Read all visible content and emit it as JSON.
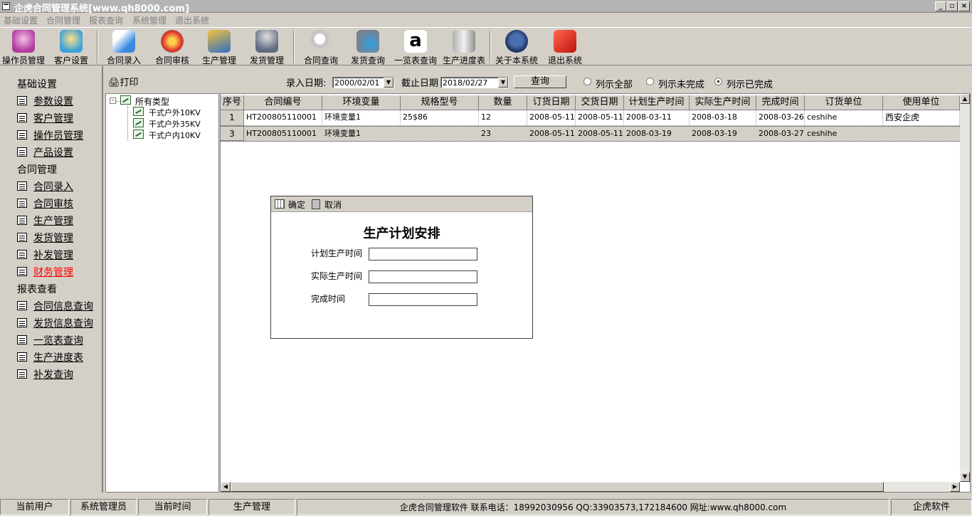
{
  "window": {
    "title": "企虎合同管理系统[www.qh8000.com]"
  },
  "menu": [
    "基础设置",
    "合同管理",
    "报表查询",
    "系统管理",
    "退出系统"
  ],
  "toolbar": [
    {
      "label": "操作员管理",
      "icon": "user-admin-icon"
    },
    {
      "label": "客户设置",
      "icon": "customer-icon"
    },
    {
      "label": "合同录入",
      "icon": "contract-entry-icon"
    },
    {
      "label": "合同审核",
      "icon": "audit-icon"
    },
    {
      "label": "生产管理",
      "icon": "production-icon"
    },
    {
      "label": "发货管理",
      "icon": "shipping-icon"
    },
    {
      "label": "合同查询",
      "icon": "search-icon"
    },
    {
      "label": "发货查询",
      "icon": "shipping-query-icon"
    },
    {
      "label": "一览表查询",
      "icon": "overview-icon"
    },
    {
      "label": "生产进度表",
      "icon": "progress-icon"
    },
    {
      "label": "关于本系统",
      "icon": "about-icon"
    },
    {
      "label": "退出系统",
      "icon": "exit-icon"
    }
  ],
  "nav": {
    "sections": [
      {
        "title": "基础设置",
        "items": [
          "参数设置",
          "客户管理",
          "操作员管理",
          "产品设置"
        ]
      },
      {
        "title": "合同管理",
        "items": [
          "合同录入",
          "合同审核",
          "生产管理",
          "发货管理",
          "补发管理",
          "财务管理"
        ]
      },
      {
        "title": "报表查看",
        "items": [
          "合同信息查询",
          "发货信息查询",
          "一览表查询",
          "生产进度表",
          "补发查询"
        ]
      }
    ],
    "highlight": "财务管理",
    "highlight_color": "#ff0000"
  },
  "filter": {
    "print": "打印",
    "entry_date_label": "录入日期:",
    "entry_date": "2000/02/01",
    "cutoff_label": "截止日期",
    "cutoff_date": "2018/02/27",
    "query": "查询",
    "radios": [
      "列示全部",
      "列示未完成",
      "列示已完成"
    ],
    "selected": "列示已完成"
  },
  "tree": {
    "root": "所有类型",
    "children": [
      "干式户外10KV",
      "干式户外35KV",
      "干式户内10KV"
    ]
  },
  "grid": {
    "columns": [
      "序号",
      "合同编号",
      "环境变量",
      "规格型号",
      "数量",
      "订货日期",
      "交货日期",
      "计划生产时间",
      "实际生产时间",
      "完成时间",
      "订货单位",
      "使用单位"
    ],
    "rows": [
      {
        "num": "1",
        "cells": [
          "HT200805110001",
          "环境变量1",
          "25$86",
          "12",
          "2008-05-11",
          "2008-05-11",
          "2008-03-11",
          "2008-03-18",
          "2008-03-26",
          "ceshihe",
          "西安企虎"
        ]
      },
      {
        "num": "3",
        "cells": [
          "HT200805110001",
          "环境变量1",
          "",
          "23",
          "2008-05-11",
          "2008-05-11",
          "2008-03-19",
          "2008-03-19",
          "2008-03-27",
          "ceshihe",
          ""
        ]
      }
    ]
  },
  "dialog": {
    "ok": "确定",
    "cancel": "取消",
    "title": "生产计划安排",
    "fields": [
      {
        "label": "计划生产时间",
        "value": ""
      },
      {
        "label": "实际生产时间",
        "value": ""
      },
      {
        "label": "完成时间",
        "value": ""
      }
    ]
  },
  "status": {
    "user_label": "当前用户",
    "user": "系统管理员",
    "time_label": "当前时间",
    "module": "生产管理",
    "info": "企虎合同管理软件    联系电话：18992030956 QQ:33903573,172184600 网址:www.qh8000.com",
    "brand": "企虎软件"
  }
}
